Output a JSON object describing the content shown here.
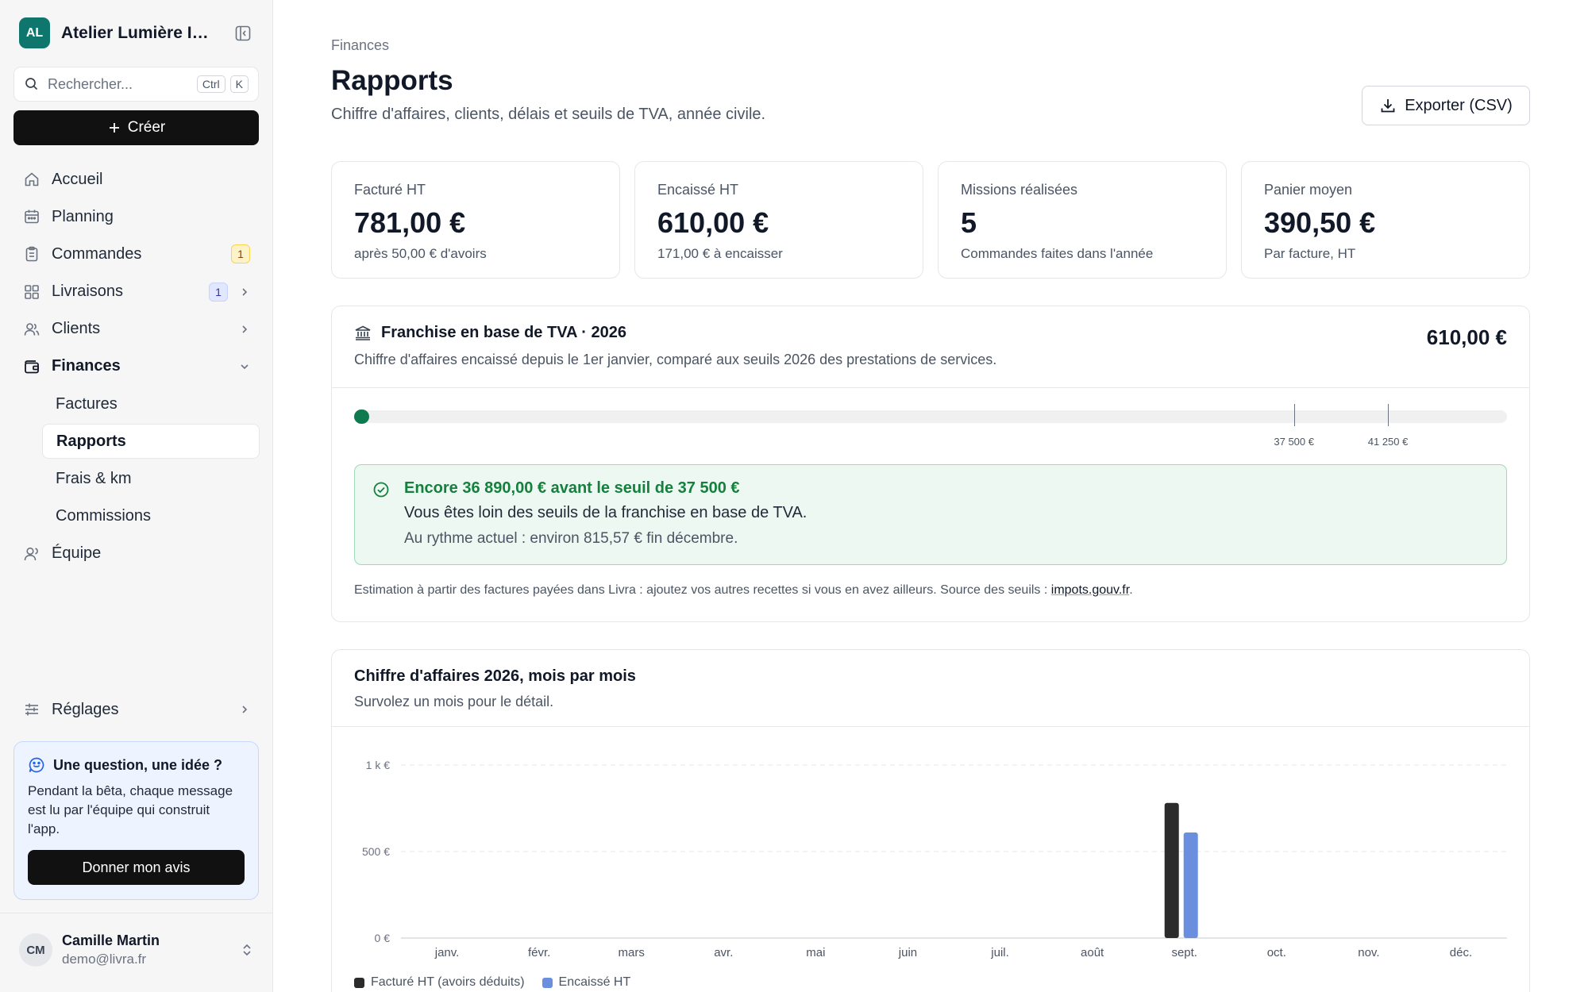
{
  "workspace": {
    "initials": "AL",
    "name": "Atelier Lumière Im..."
  },
  "search": {
    "placeholder": "Rechercher...",
    "kbd1": "Ctrl",
    "kbd2": "K"
  },
  "create_label": "Créer",
  "nav": {
    "home": "Accueil",
    "planning": "Planning",
    "orders": "Commandes",
    "orders_badge": "1",
    "deliveries": "Livraisons",
    "deliveries_badge": "1",
    "clients": "Clients",
    "finances": "Finances",
    "invoices": "Factures",
    "reports": "Rapports",
    "expenses": "Frais & km",
    "commissions": "Commissions",
    "team": "Équipe",
    "settings": "Réglages"
  },
  "feedback": {
    "title": "Une question, une idée ?",
    "text": "Pendant la bêta, chaque message est lu par l'équipe qui construit l'app.",
    "button": "Donner mon avis"
  },
  "user": {
    "initials": "CM",
    "name": "Camille Martin",
    "email": "demo@livra.fr"
  },
  "page": {
    "breadcrumb": "Finances",
    "title": "Rapports",
    "subtitle": "Chiffre d'affaires, clients, délais et seuils de TVA, année civile.",
    "export_label": "Exporter (CSV)"
  },
  "kpis": [
    {
      "label": "Facturé HT",
      "value": "781,00 €",
      "note": "après 50,00 € d'avoirs"
    },
    {
      "label": "Encaissé HT",
      "value": "610,00 €",
      "note": "171,00 € à encaisser"
    },
    {
      "label": "Missions réalisées",
      "value": "5",
      "note": "Commandes faites dans l'année"
    },
    {
      "label": "Panier moyen",
      "value": "390,50 €",
      "note": "Par facture, HT"
    }
  ],
  "vat": {
    "title": "Franchise en base de TVA · 2026",
    "description": "Chiffre d'affaires encaissé depuis le 1er janvier, comparé aux seuils 2026 des prestations de services.",
    "amount": "610,00 €",
    "current_value": 610,
    "scale_max": 46000,
    "thresholds": [
      {
        "value": 37500,
        "label": "37 500 €"
      },
      {
        "value": 41250,
        "label": "41 250 €"
      }
    ],
    "status_title": "Encore 36 890,00 € avant le seuil de 37 500 €",
    "status_line": "Vous êtes loin des seuils de la franchise en base de TVA.",
    "status_projection": "Au rythme actuel : environ 815,57 € fin décembre.",
    "footnote": "Estimation à partir des factures payées dans Livra : ajoutez vos autres recettes si vous en avez ailleurs. Source des seuils : ",
    "footnote_link": "impots.gouv.fr",
    "footnote_end": "."
  },
  "chart": {
    "title": "Chiffre d'affaires 2026, mois par mois",
    "subtitle": "Survolez un mois pour le détail."
  },
  "chart_data": {
    "type": "bar",
    "categories": [
      "janv.",
      "févr.",
      "mars",
      "avr.",
      "mai",
      "juin",
      "juil.",
      "août",
      "sept.",
      "oct.",
      "nov.",
      "déc."
    ],
    "series": [
      {
        "name": "Facturé HT (avoirs déduits)",
        "color": "#2b2b2b",
        "values": [
          0,
          0,
          0,
          0,
          0,
          0,
          0,
          0,
          781,
          0,
          0,
          0
        ]
      },
      {
        "name": "Encaissé HT",
        "color": "#6b8fdf",
        "values": [
          0,
          0,
          0,
          0,
          0,
          0,
          0,
          0,
          610,
          0,
          0,
          0
        ]
      }
    ],
    "yticks": [
      {
        "value": 0,
        "label": "0 €"
      },
      {
        "value": 500,
        "label": "500 €"
      },
      {
        "value": 1000,
        "label": "1 k €"
      }
    ],
    "ylim": [
      0,
      1000
    ],
    "legend": "bottom-left"
  }
}
